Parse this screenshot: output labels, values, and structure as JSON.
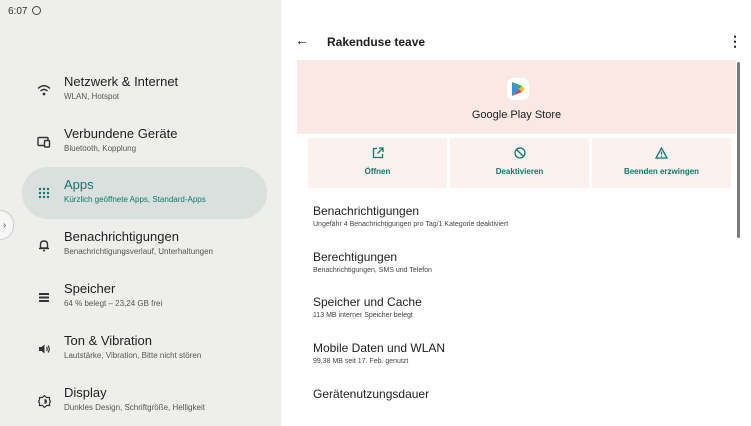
{
  "status_bar": {
    "time": "6:07"
  },
  "nav": [
    {
      "title": "Netzwerk & Internet",
      "subtitle": "WLAN, Hotspot",
      "icon": "wifi-icon",
      "active": false
    },
    {
      "title": "Verbundene Geräte",
      "subtitle": "Bluetooth, Kopplung",
      "icon": "devices-icon",
      "active": false
    },
    {
      "title": "Apps",
      "subtitle": "Kürzlich geöffnete Apps, Standard-Apps",
      "icon": "apps-grid-icon",
      "active": true
    },
    {
      "title": "Benachrichtigungen",
      "subtitle": "Benachrichtigungsverlauf, Unterhaltungen",
      "icon": "bell-icon",
      "active": false
    },
    {
      "title": "Speicher",
      "subtitle": "64 % belegt – 23,24 GB frei",
      "icon": "storage-icon",
      "active": false
    },
    {
      "title": "Ton & Vibration",
      "subtitle": "Lautstärke, Vibration, Bitte nicht stören",
      "icon": "volume-icon",
      "active": false
    },
    {
      "title": "Display",
      "subtitle": "Dunkles Design, Schriftgröße, Helligkeit",
      "icon": "brightness-icon",
      "active": false
    }
  ],
  "detail": {
    "title": "Rakenduse teave",
    "app_name": "Google Play Store",
    "actions": [
      {
        "label": "Öffnen",
        "icon": "open-external-icon"
      },
      {
        "label": "Deaktivieren",
        "icon": "disable-icon"
      },
      {
        "label": "Beenden erzwingen",
        "icon": "warning-icon"
      }
    ],
    "rows": [
      {
        "title": "Benachrichtigungen",
        "subtitle": "Ungefähr 4 Benachrichtigungen pro Tag/1 Kategorie deaktiviert"
      },
      {
        "title": "Berechtigungen",
        "subtitle": "Benachrichtigungen, SMS und Telefon"
      },
      {
        "title": "Speicher und Cache",
        "subtitle": "113 MB interner Speicher belegt"
      },
      {
        "title": "Mobile Daten und WLAN",
        "subtitle": "99,38 MB seit 17. Feb. genutzt"
      },
      {
        "title": "Gerätenutzungsdauer",
        "subtitle": ""
      }
    ]
  },
  "colors": {
    "accent": "#0b7a6d",
    "active_nav_bg": "#d9e0dd",
    "app_header_bg": "#f9e8e3"
  }
}
